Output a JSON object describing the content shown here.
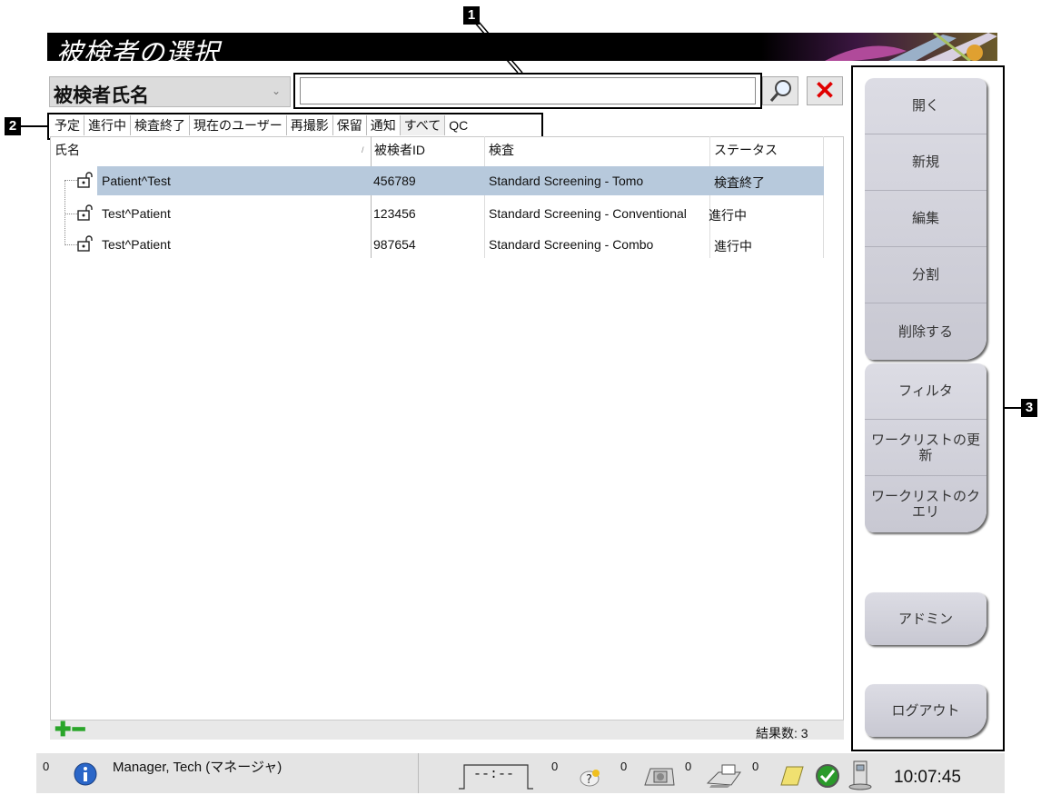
{
  "window": {
    "title": "被検者の選択"
  },
  "search": {
    "field_label": "被検者氏名",
    "value": "",
    "placeholder": ""
  },
  "tabs": [
    "予定",
    "進行中",
    "検査終了",
    "現在のユーザー",
    "再撮影",
    "保留",
    "通知",
    "すべて",
    "QC"
  ],
  "grid": {
    "columns": [
      "氏名",
      "被検者ID",
      "検査",
      "ステータス"
    ],
    "rows": [
      {
        "name": "Patient^Test",
        "id": "456789",
        "exam": "Standard Screening - Tomo",
        "status": "検査終了",
        "selected": true
      },
      {
        "name": "Test^Patient",
        "id": "123456",
        "exam": "Standard Screening - Conventional",
        "status": "進行中",
        "selected": false
      },
      {
        "name": "Test^Patient",
        "id": "987654",
        "exam": "Standard Screening - Combo",
        "status": "進行中",
        "selected": false
      }
    ],
    "result_count": "結果数: 3"
  },
  "buttons": {
    "group1": [
      "開く",
      "新規",
      "編集",
      "分割",
      "削除する"
    ],
    "group2": [
      "フィルタ",
      "ワークリストの更新",
      "ワークリストのクエリ"
    ],
    "admin": "アドミン",
    "logout": "ログアウト"
  },
  "callouts": [
    "1",
    "2",
    "3"
  ],
  "status_bar": {
    "alerts_count": "0",
    "user": "Manager, Tech (マネージャ)",
    "timer": "--:--",
    "counts": [
      "0",
      "0",
      "0",
      "0"
    ],
    "time": "10:07:45"
  },
  "colors": {
    "selected_row": "#b7c9dc",
    "accent_red": "#e00000",
    "accent_green": "#2aa52a"
  }
}
